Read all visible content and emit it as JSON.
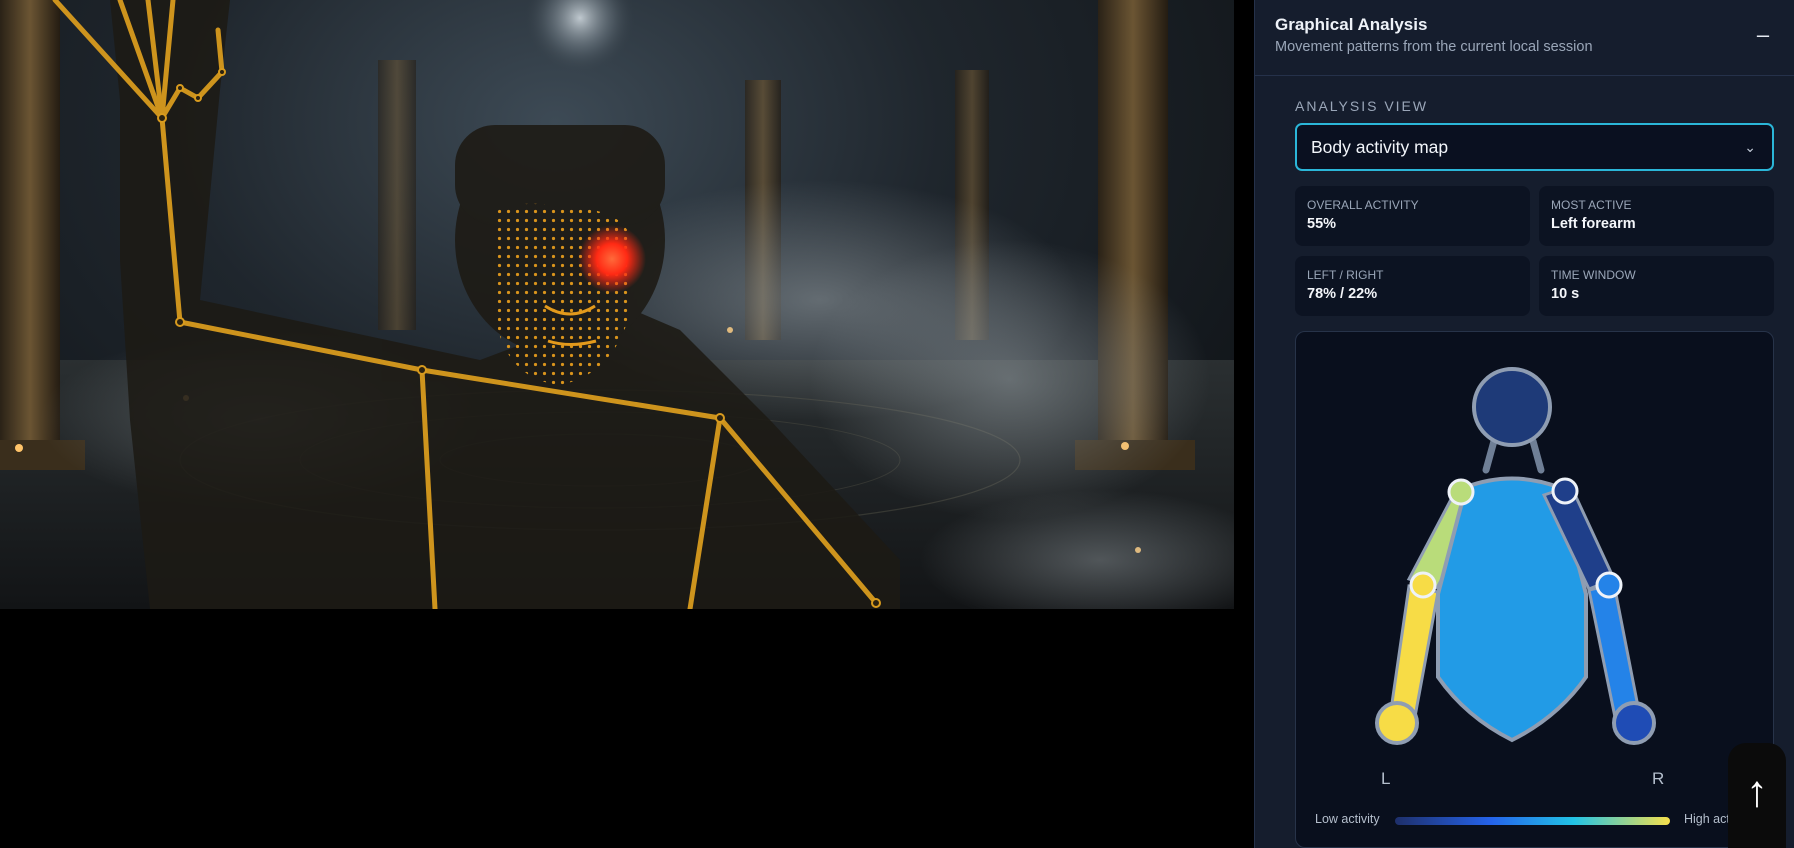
{
  "panel": {
    "title": "Graphical Analysis",
    "subtitle": "Movement patterns from the current local session",
    "collapse_label": "–",
    "analysis_view_label": "ANALYSIS VIEW",
    "analysis_view_selected": "Body activity map"
  },
  "stats": [
    {
      "label": "OVERALL ACTIVITY",
      "value": "55%"
    },
    {
      "label": "MOST ACTIVE",
      "value": "Left forearm"
    },
    {
      "label": "LEFT / RIGHT",
      "value": "78% / 22%"
    },
    {
      "label": "TIME WINDOW",
      "value": "10 s"
    }
  ],
  "body_map": {
    "left_label": "L",
    "right_label": "R",
    "legend_low": "Low activity",
    "legend_high": "High activity",
    "colors": {
      "head": "#1e3a78",
      "torso": "#229be6",
      "left_upper_arm": "#b9dc7a",
      "left_forearm": "#f7dc46",
      "left_hand": "#f7dc46",
      "right_upper_arm": "#1f3f8a",
      "right_forearm": "#2483e8",
      "right_hand": "#1f4cb5",
      "outline": "#8f9db2"
    }
  },
  "scroll_top_icon": "↑",
  "overlay_colors": {
    "skeleton": "#d89b1e",
    "face_mesh": "#e39a1c",
    "eye_glow": "#ff2a14"
  }
}
